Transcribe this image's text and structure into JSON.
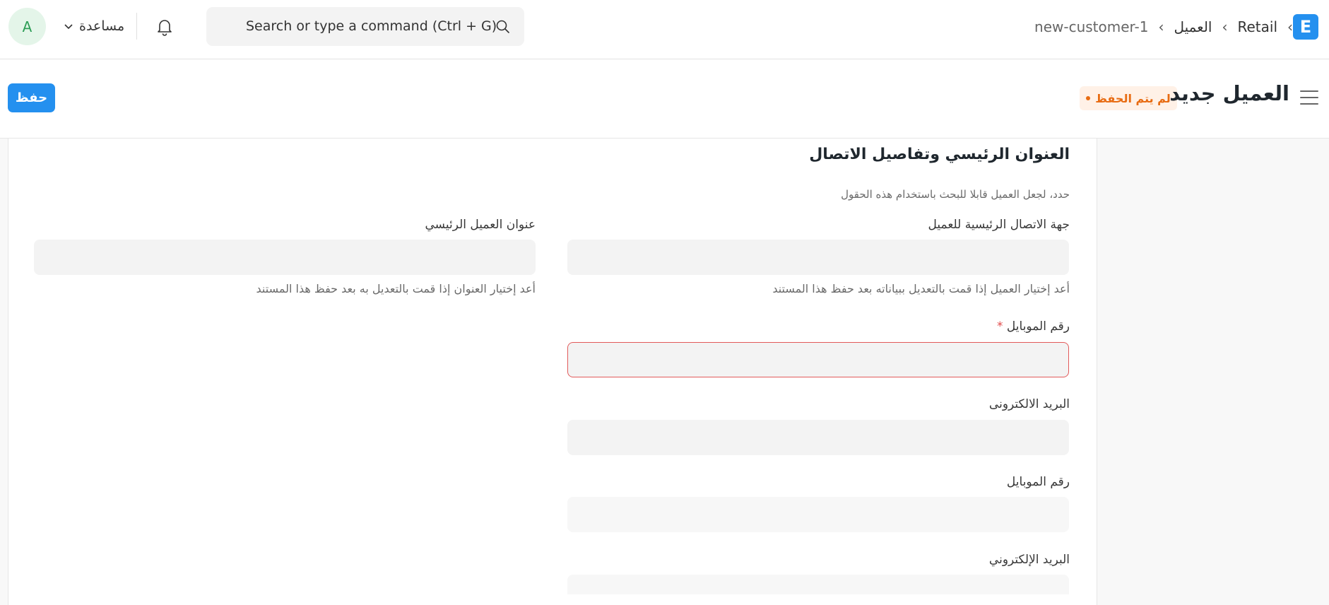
{
  "navbar": {
    "user_initial": "A",
    "help_label": "مساعدة",
    "search_placeholder": "Search or type a command (Ctrl + G)",
    "breadcrumbs": [
      "Retail",
      "العميل",
      "new-customer-1"
    ],
    "logo_letter": "E"
  },
  "page": {
    "title": "العميل جديد",
    "status_badge": "لم يتم الحفظ",
    "save_label": "حفظ"
  },
  "section": {
    "title": "العنوان الرئيسي وتفاصيل الاتصال",
    "description": "حدد، لجعل العميل قابلا للبحث باستخدام هذه الحقول",
    "fields": {
      "primary_contact": {
        "label": "جهة الاتصال الرئيسية للعميل",
        "value": "",
        "help": "أعد إختيار العميل إذا قمت بالتعديل ببياناته بعد حفظ هذا المستند"
      },
      "primary_address": {
        "label": "عنوان العميل الرئيسي",
        "value": "",
        "help": "أعد إختيار العنوان إذا قمت بالتعديل به بعد حفظ هذا المستند"
      },
      "mobile_no": {
        "label": "رقم الموبايل",
        "required_mark": "*",
        "value": ""
      },
      "email_id": {
        "label": "البريد الالكترونى",
        "value": ""
      },
      "mobile_no_2": {
        "label": "رقم الموبايل",
        "value": ""
      },
      "email_id_2": {
        "label": "البريد الإلكتروني",
        "value": ""
      }
    }
  },
  "colors": {
    "primary": "#2490ef",
    "warning": "#e86c13",
    "error": "#e25a5a"
  }
}
